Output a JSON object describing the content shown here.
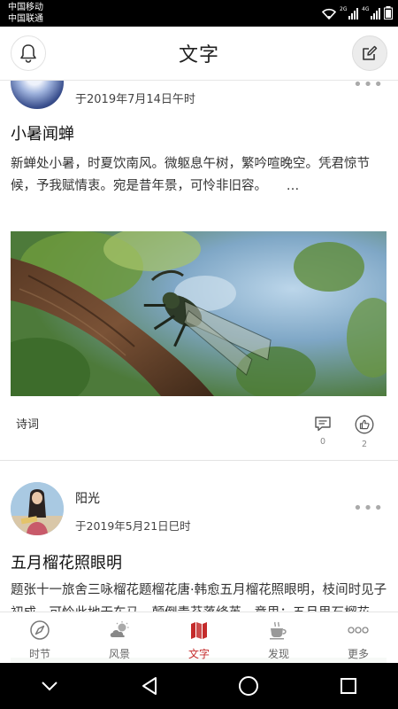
{
  "status_bar": {
    "carrier_1": "中国移动",
    "carrier_2": "中国联通",
    "network_1": "2G",
    "network_2": "4G"
  },
  "header": {
    "title": "文字",
    "left_icon": "bell-icon",
    "right_icon": "edit-icon"
  },
  "posts": [
    {
      "date": "于2019年7月14日午时",
      "title": "小暑闻蝉",
      "body": "新蝉处小暑，时夏饮南风。微躯息午树，繁吟喧晚空。凭君惊节候，予我赋情衷。宛是昔年景，可怜非旧容。　　…",
      "image": "cicada-on-branch-photo",
      "tag": "诗词",
      "comments": "0",
      "likes": "2"
    },
    {
      "author": "阳光",
      "date": "于2019年5月21日巳时",
      "title": "五月榴花照眼明",
      "body": "题张十一旅舍三咏榴花题榴花唐·韩愈五月榴花照眼明，枝间时见子初成。可怜此地无车马，颠倒青苔落绛英。意思：五月里石榴花开，红艳似火，耀眼夺目，…仿佛可见榴子挂于枝子深，惊…"
    }
  ],
  "tabs": [
    {
      "label": "时节",
      "icon": "compass-icon"
    },
    {
      "label": "风景",
      "icon": "weather-icon"
    },
    {
      "label": "文字",
      "icon": "book-map-icon"
    },
    {
      "label": "发现",
      "icon": "coffee-cup-icon"
    },
    {
      "label": "更多",
      "icon": "more-dots-icon"
    }
  ],
  "active_tab": "文字",
  "colors": {
    "accent": "#c42b2b",
    "status_bar": "#000000",
    "nav_bar": "#000000"
  }
}
